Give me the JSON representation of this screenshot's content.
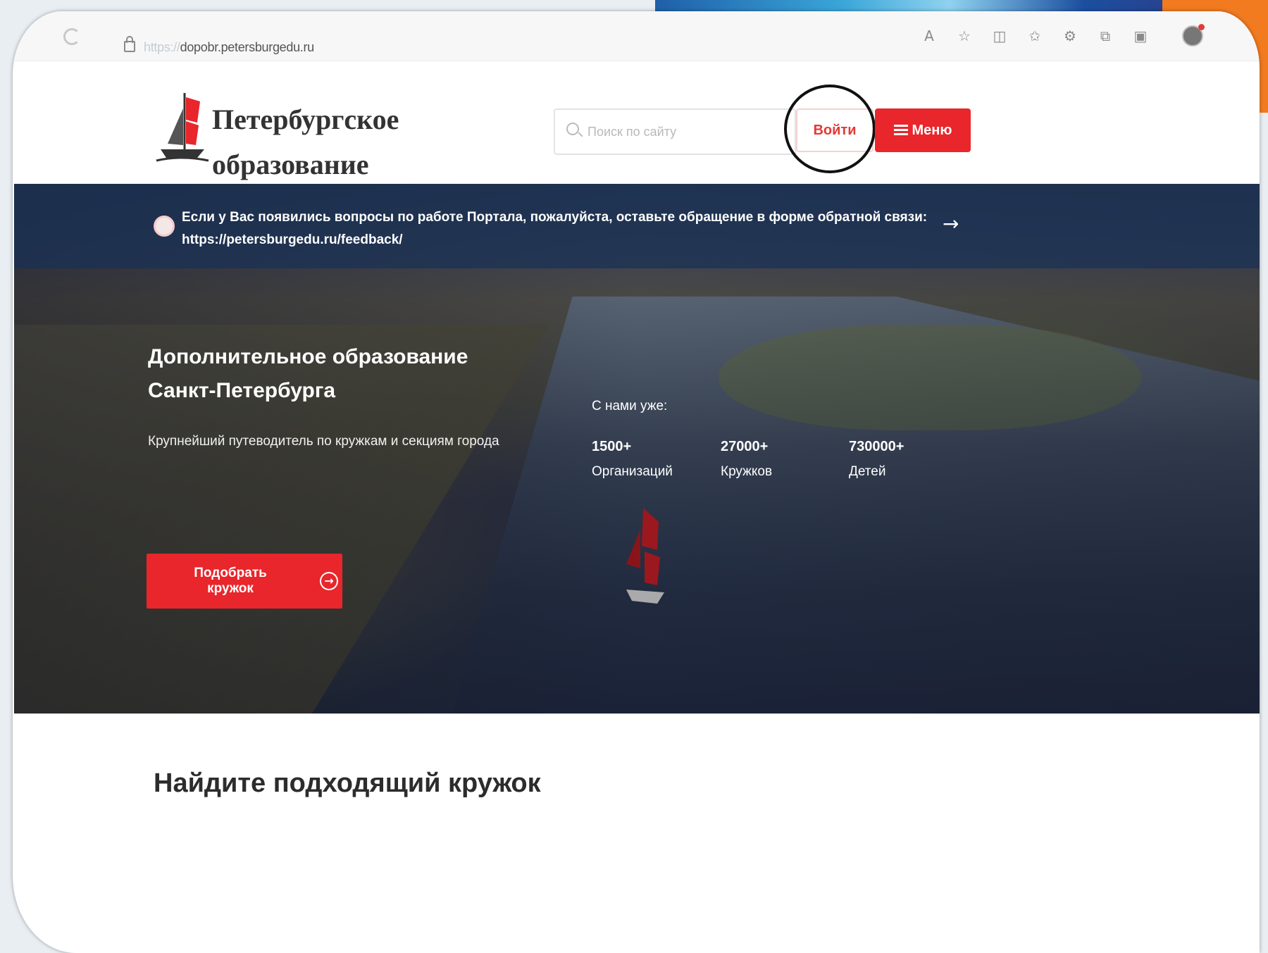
{
  "browser": {
    "url_scheme": "https://",
    "url_host": "dopobr.petersburgedu.ru",
    "toolbar_icons": [
      "read-aloud-icon",
      "favorite-star-icon",
      "split-view-icon",
      "favorites-icon",
      "extensions-icon",
      "collections-icon",
      "screenshot-icon",
      "profile-icon"
    ]
  },
  "header": {
    "site_title_line1": "Петербургское",
    "site_title_line2": "образование",
    "search_placeholder": "Поиск по сайту",
    "login_label": "Войти",
    "menu_label": "Меню"
  },
  "hero": {
    "notice_text": "Если у Вас появились вопросы по работе Портала, пожалуйста, оставьте обращение в форме обратной связи:",
    "notice_link": "https://petersburgedu.ru/feedback/",
    "title_line1": "Дополнительное образование",
    "title_line2": "Санкт-Петербурга",
    "subtitle": "Крупнейший путеводитель по кружкам и секциям города",
    "stats_label": "С нами уже:",
    "stats": [
      {
        "value": "1500+",
        "label": "Организаций"
      },
      {
        "value": "27000+",
        "label": "Кружков"
      },
      {
        "value": "730000+",
        "label": "Детей"
      }
    ],
    "cta_label": "Подобрать кружок"
  },
  "section": {
    "title": "Найдите подходящий кружок"
  },
  "colors": {
    "accent_red": "#e8262b",
    "highlight_circle": "#111111"
  }
}
